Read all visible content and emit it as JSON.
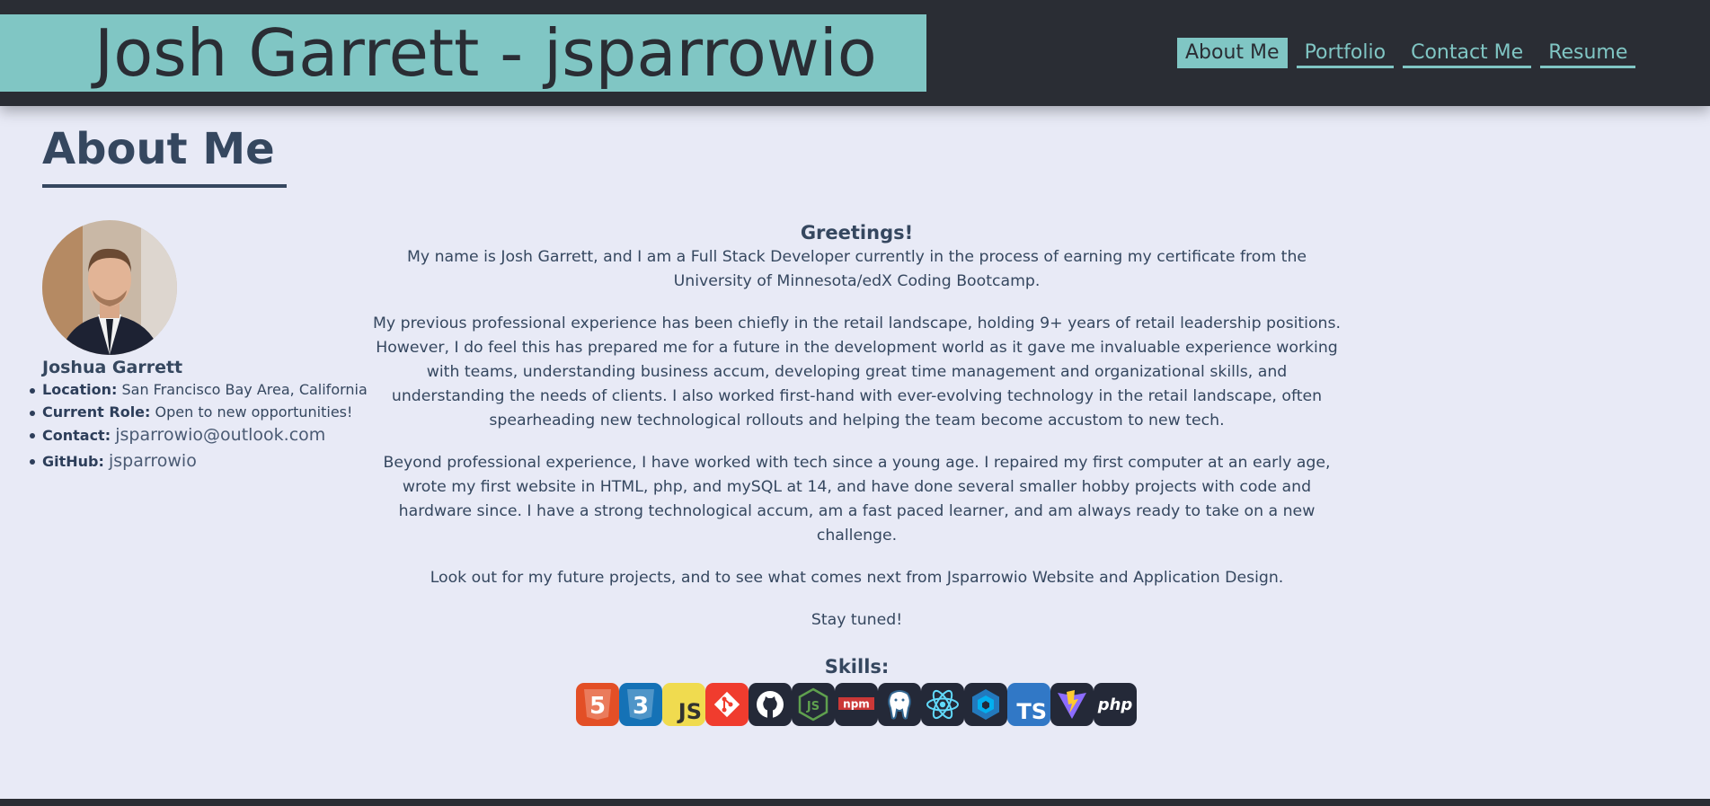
{
  "header": {
    "site_title": "Josh Garrett - jsparrowio",
    "nav": [
      {
        "label": "About Me",
        "active": true
      },
      {
        "label": "Portfolio",
        "active": false
      },
      {
        "label": "Contact Me",
        "active": false
      },
      {
        "label": "Resume",
        "active": false
      }
    ]
  },
  "about": {
    "title": "About Me",
    "profile": {
      "name": "Joshua Garrett",
      "location_label": "Location:",
      "location": "San Francisco Bay Area, California",
      "role_label": "Current Role:",
      "role": "Open to new opportunities!",
      "contact_label": "Contact:",
      "contact": "jsparrowio@outlook.com",
      "github_label": "GitHub:",
      "github": "jsparrowio"
    },
    "greeting": "Greetings!",
    "paragraphs": [
      "My name is Josh Garrett, and I am a Full Stack Developer currently in the process of earning my certificate from the University of Minnesota/edX Coding Bootcamp.",
      "My previous professional experience has been chiefly in the retail landscape, holding 9+ years of retail leadership positions. However, I do feel this has prepared me for a future in the development world as it gave me invaluable experience working with teams, understanding business accum, developing great time management and organizational skills, and understanding the needs of clients. I also worked first-hand with ever-evolving technology in the retail landscape, often spearheading new technological rollouts and helping the team become accustom to new tech.",
      "Beyond professional experience, I have worked with tech since a young age. I repaired my first computer at an early age, wrote my first website in HTML, php, and mySQL at 14, and have done several smaller hobby projects with code and hardware since. I have a strong technological accum, am a fast paced learner, and am always ready to take on a new challenge.",
      "Look out for my future projects, and to see what comes next from Jsparrowio Website and Application Design.",
      "Stay tuned!"
    ],
    "skills_title": "Skills:",
    "skills": [
      {
        "icon": "html5-icon",
        "text": "5",
        "bg": "#e34f26"
      },
      {
        "icon": "css3-icon",
        "text": "3",
        "bg": "#1572b6"
      },
      {
        "icon": "javascript-icon",
        "text": "JS",
        "bg": "#f0db4f"
      },
      {
        "icon": "git-icon",
        "text": "",
        "bg": "#f03c2e"
      },
      {
        "icon": "github-icon",
        "text": "",
        "bg": "#242938"
      },
      {
        "icon": "nodejs-icon",
        "text": "JS",
        "bg": "#242938"
      },
      {
        "icon": "npm-icon",
        "text": "npm",
        "bg": "#242938"
      },
      {
        "icon": "postgresql-icon",
        "text": "",
        "bg": "#242938"
      },
      {
        "icon": "react-icon",
        "text": "",
        "bg": "#242938"
      },
      {
        "icon": "sequelize-icon",
        "text": "",
        "bg": "#242938"
      },
      {
        "icon": "typescript-icon",
        "text": "TS",
        "bg": "#3178c6"
      },
      {
        "icon": "vite-icon",
        "text": "",
        "bg": "#242938"
      },
      {
        "icon": "php-icon",
        "text": "php",
        "bg": "#242938"
      }
    ]
  }
}
